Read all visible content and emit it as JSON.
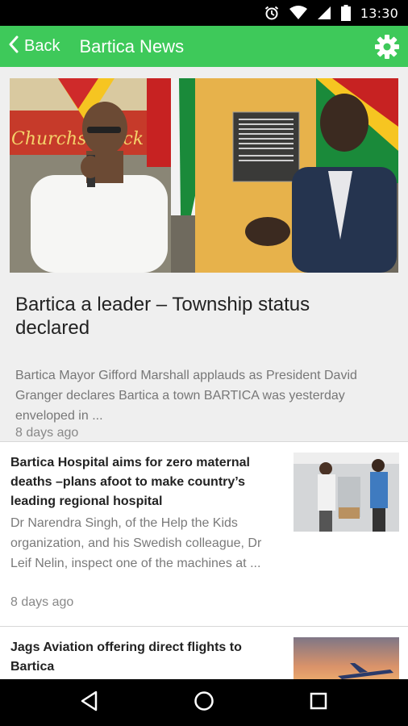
{
  "status_bar": {
    "time": "13:30",
    "icons": [
      "alarm-icon",
      "wifi-icon",
      "signal-icon",
      "battery-icon"
    ]
  },
  "app_bar": {
    "back_label": "Back",
    "title": "Bartica News",
    "settings_icon": "gear-icon",
    "color": "#3ec95a"
  },
  "featured": {
    "title": "Bartica a leader – Township status declared",
    "summary": "Bartica Mayor Gifford Marshall applauds as President David Granger declares Bartica a town BARTICA was yesterday enveloped in ...",
    "time": "8 days ago",
    "image_signage": "Churchs Chick"
  },
  "articles": [
    {
      "title": "Bartica Hospital aims for zero maternal deaths –plans afoot to make country’s leading regional hospital",
      "summary": "Dr Narendra Singh, of the Help the Kids organization, and his Swedish colleague, Dr Leif Nelin, inspect one of the machines at ...",
      "time": "8 days ago"
    },
    {
      "title": "Jags Aviation offering direct flights to Bartica",
      "summary": "",
      "time": ""
    }
  ],
  "nav_bar": {
    "icons": [
      "back-triangle-icon",
      "home-circle-icon",
      "recents-square-icon"
    ]
  }
}
